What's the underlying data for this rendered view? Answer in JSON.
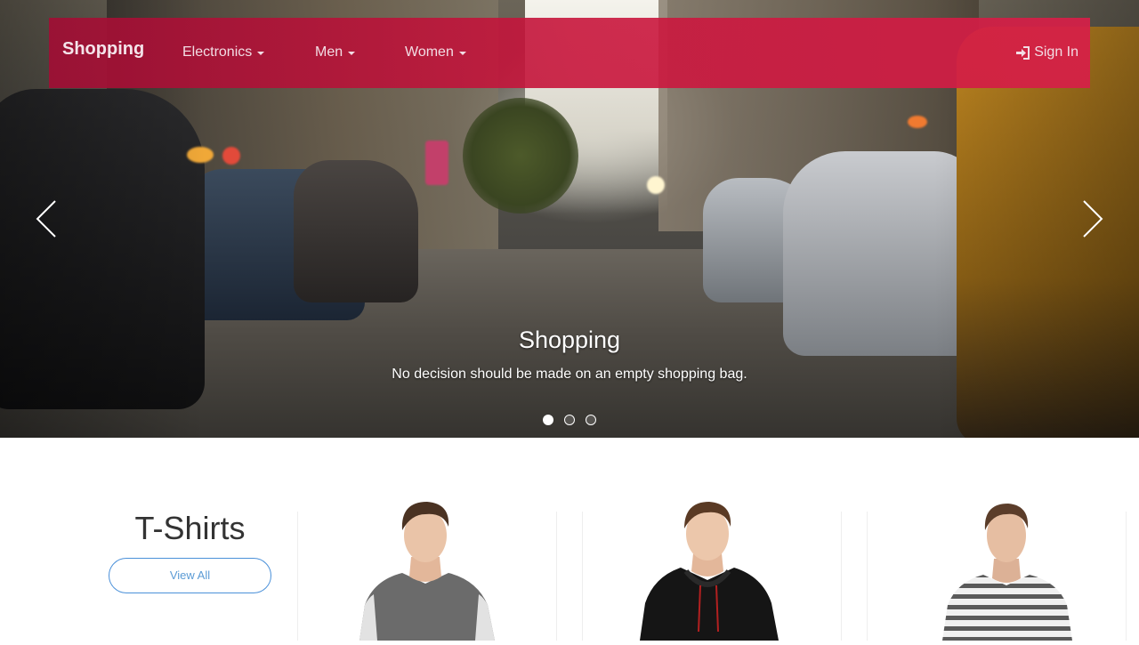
{
  "navbar": {
    "brand": "Shopping",
    "items": [
      {
        "label": "Electronics",
        "has_dropdown": true
      },
      {
        "label": "Men",
        "has_dropdown": true
      },
      {
        "label": "Women",
        "has_dropdown": true
      }
    ],
    "signin_label": "Sign In",
    "signin_icon": "sign-in-icon",
    "background_color": "#c8163c"
  },
  "carousel": {
    "caption_title": "Shopping",
    "caption_text": "No decision should be made on an empty shopping bag.",
    "slide_count": 3,
    "active_slide": 1,
    "prev_icon": "chevron-left-icon",
    "next_icon": "chevron-right-icon"
  },
  "category": {
    "title": "T-Shirts",
    "view_all_label": "View All",
    "accent_color": "#4a90d9",
    "products": [
      {
        "image": "grey-raglan-tshirt"
      },
      {
        "image": "black-hoodie"
      },
      {
        "image": "striped-tshirt"
      }
    ]
  }
}
